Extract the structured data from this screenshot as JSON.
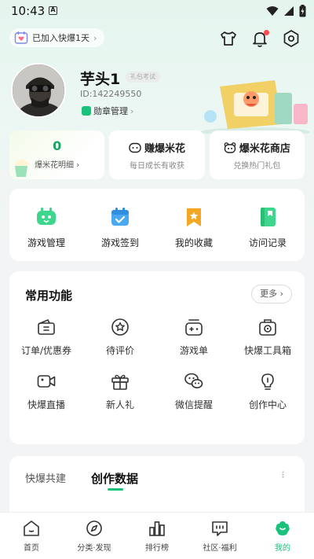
{
  "status_bar": {
    "time": "10:43",
    "notification_letter": "A"
  },
  "header": {
    "joined_text": "已加入快爆1天"
  },
  "profile": {
    "username": "芋头1",
    "level_tag": "礼包考试",
    "user_id": "ID:142249550",
    "badge_label": "勋章管理"
  },
  "cards": [
    {
      "value": "0",
      "subtitle": "爆米花明细"
    },
    {
      "title": "赚爆米花",
      "subtitle": "每日成长有收获"
    },
    {
      "title": "爆米花商店",
      "subtitle": "兑换热门礼包"
    }
  ],
  "quick_links": [
    {
      "label": "游戏管理",
      "icon": "gamepad-icon",
      "color": "#3dd68c"
    },
    {
      "label": "游戏签到",
      "icon": "calendar-check-icon",
      "color": "#4aa8f0"
    },
    {
      "label": "我的收藏",
      "icon": "bookmark-star-icon",
      "color": "#f5a623"
    },
    {
      "label": "访问记录",
      "icon": "book-icon",
      "color": "#3dd68c"
    }
  ],
  "common": {
    "title": "常用功能",
    "more_label": "更多",
    "items": [
      {
        "label": "订单/优惠券",
        "icon": "coupon-icon"
      },
      {
        "label": "待评价",
        "icon": "star-badge-icon"
      },
      {
        "label": "游戏单",
        "icon": "game-list-icon"
      },
      {
        "label": "快爆工具箱",
        "icon": "toolbox-icon"
      },
      {
        "label": "快爆直播",
        "icon": "video-camera-icon"
      },
      {
        "label": "新人礼",
        "icon": "gift-icon"
      },
      {
        "label": "微信提醒",
        "icon": "wechat-icon"
      },
      {
        "label": "创作中心",
        "icon": "lightbulb-icon"
      }
    ]
  },
  "stats_tabs": [
    {
      "label": "快爆共建",
      "active": false
    },
    {
      "label": "创作数据",
      "active": true
    }
  ],
  "bottom_nav": [
    {
      "label": "首页",
      "icon": "home-icon"
    },
    {
      "label": "分类·发现",
      "icon": "compass-icon"
    },
    {
      "label": "排行榜",
      "icon": "ranking-icon"
    },
    {
      "label": "社区·福利",
      "icon": "community-icon"
    },
    {
      "label": "我的",
      "icon": "profile-icon",
      "active": true
    }
  ],
  "colors": {
    "accent": "#19c17b",
    "notification": "#ff4d4f"
  }
}
